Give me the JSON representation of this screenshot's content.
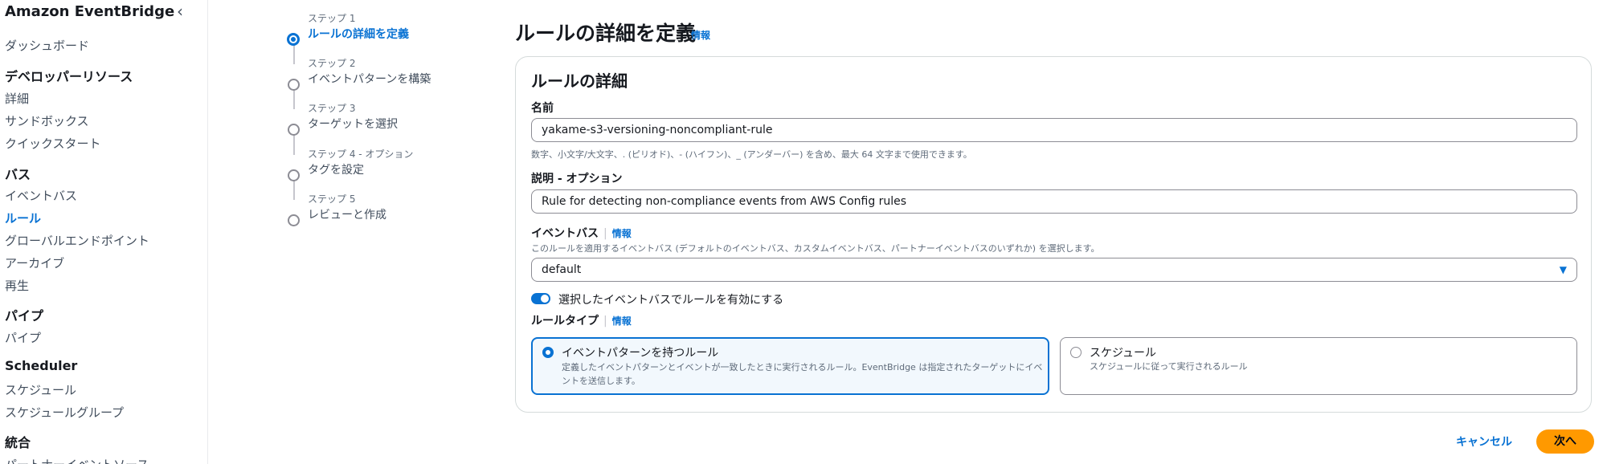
{
  "nav": {
    "title": "Amazon EventBridge",
    "collapse_icon": "chevron-left-icon",
    "items": [
      {
        "label": "ダッシュボード",
        "type": "item"
      },
      {
        "label": "デベロッパーリソース",
        "type": "heading"
      },
      {
        "label": "詳細",
        "type": "item"
      },
      {
        "label": "サンドボックス",
        "type": "item"
      },
      {
        "label": "クイックスタート",
        "type": "item"
      },
      {
        "label": "バス",
        "type": "heading"
      },
      {
        "label": "イベントバス",
        "type": "item"
      },
      {
        "label": "ルール",
        "type": "item",
        "active": true
      },
      {
        "label": "グローバルエンドポイント",
        "type": "item"
      },
      {
        "label": "アーカイブ",
        "type": "item"
      },
      {
        "label": "再生",
        "type": "item"
      },
      {
        "label": "パイプ",
        "type": "heading"
      },
      {
        "label": "パイプ",
        "type": "item"
      },
      {
        "label": "Scheduler",
        "type": "heading"
      },
      {
        "label": "スケジュール",
        "type": "item"
      },
      {
        "label": "スケジュールグループ",
        "type": "item"
      },
      {
        "label": "統合",
        "type": "heading"
      },
      {
        "label": "パートナーイベントソース",
        "type": "item"
      }
    ]
  },
  "steps": [
    {
      "label": "ステップ 1",
      "name": "ルールの詳細を定義",
      "active": true
    },
    {
      "label": "ステップ 2",
      "name": "イベントパターンを構築"
    },
    {
      "label": "ステップ 3",
      "name": "ターゲットを選択"
    },
    {
      "label": "ステップ 4 - オプション",
      "name": "タグを設定"
    },
    {
      "label": "ステップ 5",
      "name": "レビューと作成"
    }
  ],
  "main": {
    "title": "ルールの詳細を定義",
    "info": "情報",
    "card": {
      "title": "ルールの詳細",
      "name_label": "名前",
      "name_value": "yakame-s3-versioning-noncompliant-rule",
      "name_hint": "数字、小文字/大文字、. (ピリオド)、- (ハイフン)、_ (アンダーバー) を含め、最大 64 文字まで使用できます。",
      "desc_label": "説明 - オプション",
      "desc_value": "Rule for detecting non-compliance events from AWS Config rules",
      "bus_label": "イベントバス",
      "bus_info": "情報",
      "bus_hint": "このルールを適用するイベントバス (デフォルトのイベントバス、カスタムイベントバス、パートナーイベントバスのいずれか) を選択します。",
      "bus_value": "default",
      "toggle_label": "選択したイベントバスでルールを有効にする",
      "toggle_on": true,
      "ruletype_label": "ルールタイプ",
      "ruletype_info": "情報",
      "tiles": [
        {
          "title": "イベントパターンを持つルール",
          "desc": "定義したイベントパターンとイベントが一致したときに実行されるルール。EventBridge は指定されたターゲットにイベントを送信します。",
          "selected": true
        },
        {
          "title": "スケジュール",
          "desc": "スケジュールに従って実行されるルール",
          "selected": false
        }
      ]
    },
    "cancel": "キャンセル",
    "next": "次へ"
  },
  "colors": {
    "accent": "#0972d3",
    "primary_button": "#ff9900"
  }
}
